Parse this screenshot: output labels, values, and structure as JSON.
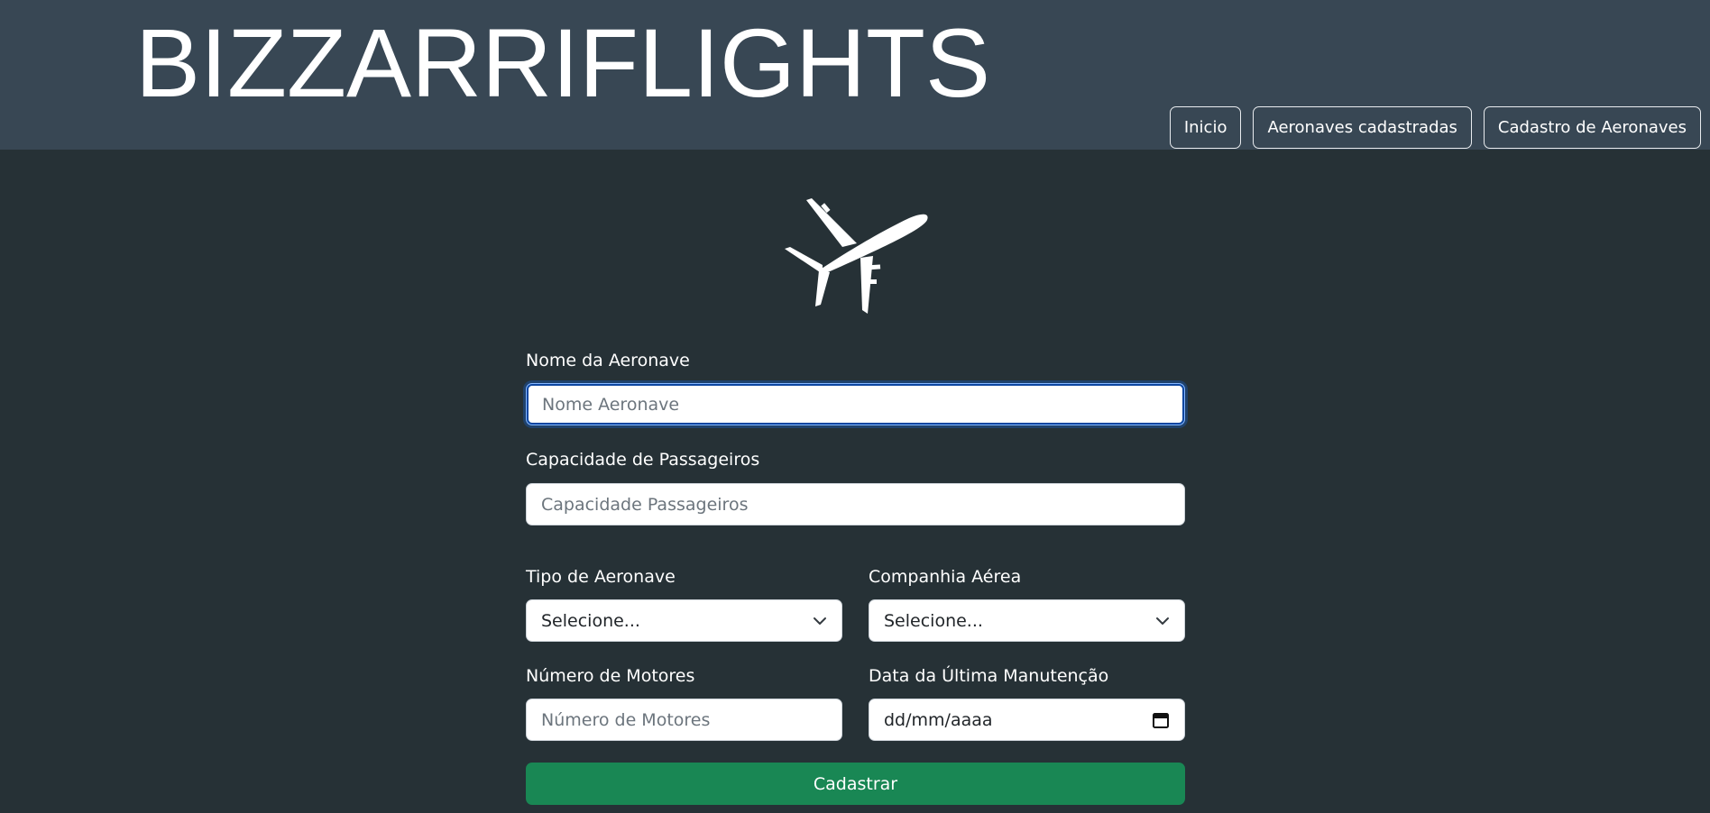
{
  "brand": "BIZZARRIFLIGHTS",
  "nav": {
    "items": [
      {
        "label": "Inicio"
      },
      {
        "label": "Aeronaves cadastradas"
      },
      {
        "label": "Cadastro de Aeronaves"
      }
    ]
  },
  "icon": {
    "name": "airplane-icon"
  },
  "form": {
    "nome": {
      "label": "Nome da Aeronave",
      "placeholder": "Nome Aeronave",
      "value": ""
    },
    "capacidade": {
      "label": "Capacidade de Passageiros",
      "placeholder": "Capacidade Passageiros",
      "value": ""
    },
    "tipo": {
      "label": "Tipo de Aeronave",
      "selected": "Selecione..."
    },
    "companhia": {
      "label": "Companhia Aérea",
      "selected": "Selecione..."
    },
    "motores": {
      "label": "Número de Motores",
      "placeholder": "Número de Motores",
      "value": ""
    },
    "manutencao": {
      "label": "Data da Última Manutenção",
      "value": "dd/mm/aaaa"
    },
    "submit_label": "Cadastrar"
  },
  "colors": {
    "header_bg": "#384754",
    "page_bg": "#263136",
    "submit_bg": "#198754"
  }
}
